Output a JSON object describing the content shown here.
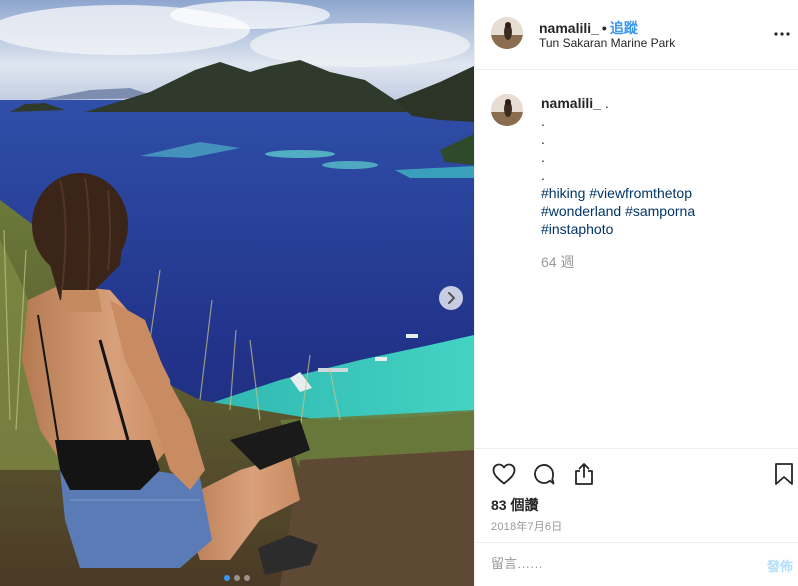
{
  "post": {
    "username": "namalili_",
    "separator": "•",
    "follow_label": "追蹤",
    "location": "Tun Sakaran Marine Park",
    "more_icon": "more-horizontal-icon",
    "next_icon": "chevron-right-icon",
    "carousel": {
      "total": 3,
      "current": 1
    }
  },
  "caption": {
    "username": "namalili_",
    "first_text": ".",
    "dot_lines": [
      ".",
      ".",
      ".",
      "."
    ],
    "hashtag_lines": [
      [
        "#hiking",
        "#viewfromthetop"
      ],
      [
        "#wonderland",
        "#samporna"
      ],
      [
        "#instaphoto"
      ]
    ],
    "time_ago": "64 週"
  },
  "actions": {
    "like_icon": "heart-icon",
    "comment_icon": "comment-icon",
    "share_icon": "share-icon",
    "save_icon": "bookmark-icon",
    "likes_text": "83 個讚",
    "date": "2018年7月6日"
  },
  "comment": {
    "placeholder": "留言……",
    "post_label": "發佈"
  },
  "colors": {
    "link_blue": "#3897f0",
    "hashtag": "#003569",
    "muted": "#999999",
    "post_disabled": "#b2dffc"
  }
}
